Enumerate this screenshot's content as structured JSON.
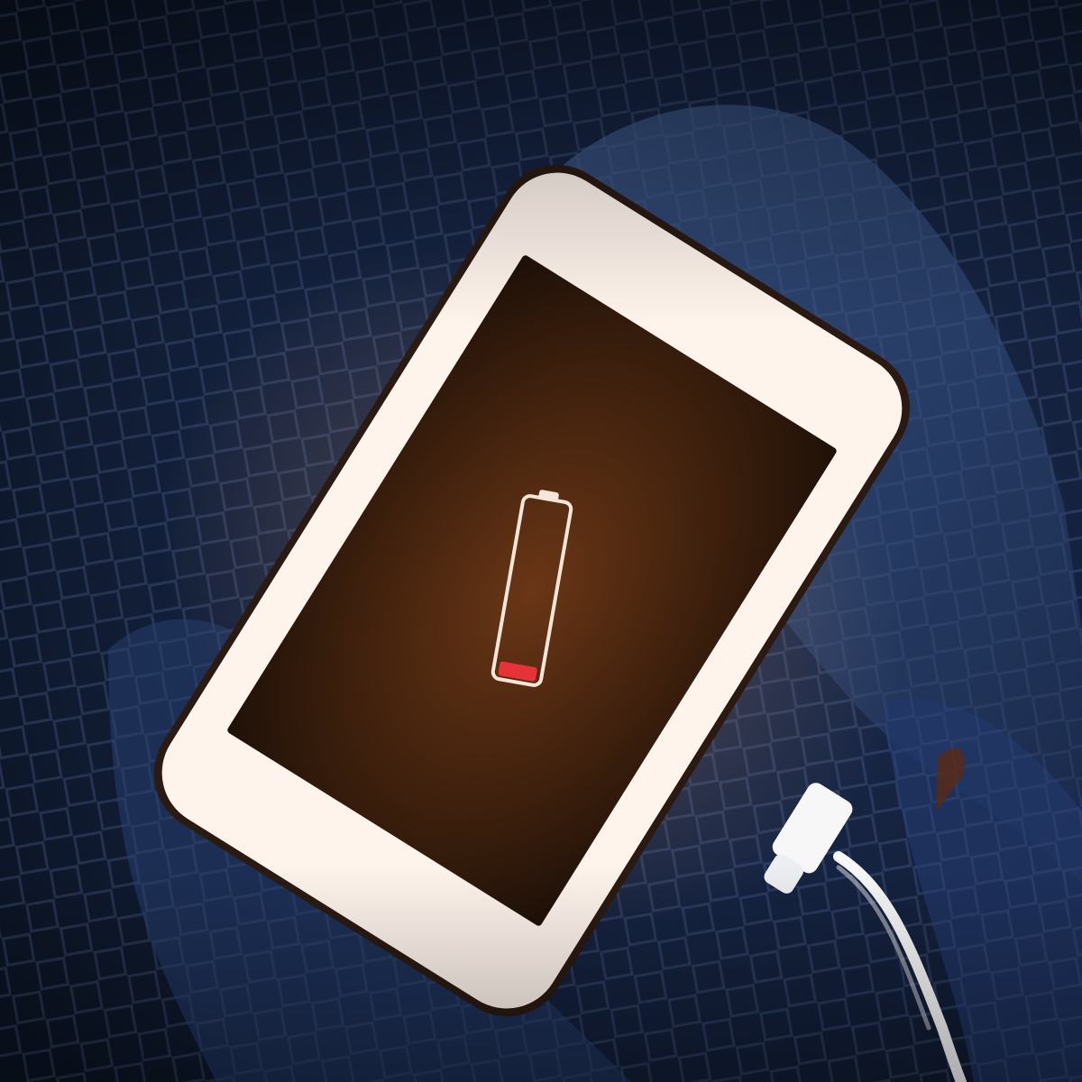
{
  "scene": {
    "subject": "smartphone-charging",
    "icons": [
      "battery-low-icon",
      "charging-cable-icon"
    ],
    "battery": {
      "level_fraction": 0.08,
      "state": "low"
    }
  },
  "colors": {
    "fabric_dark": "#0b1322",
    "fabric_mid": "#1c2d52",
    "fabric_light": "#3b5482",
    "phone_body": "#fff4ec",
    "phone_edge": "#2a1a12",
    "screen_center": "#6a3616",
    "screen_edge": "#1f1108",
    "battery_outline": "#f6e6d8",
    "battery_level": "#e8323a",
    "cable": "#f7f7f7"
  }
}
